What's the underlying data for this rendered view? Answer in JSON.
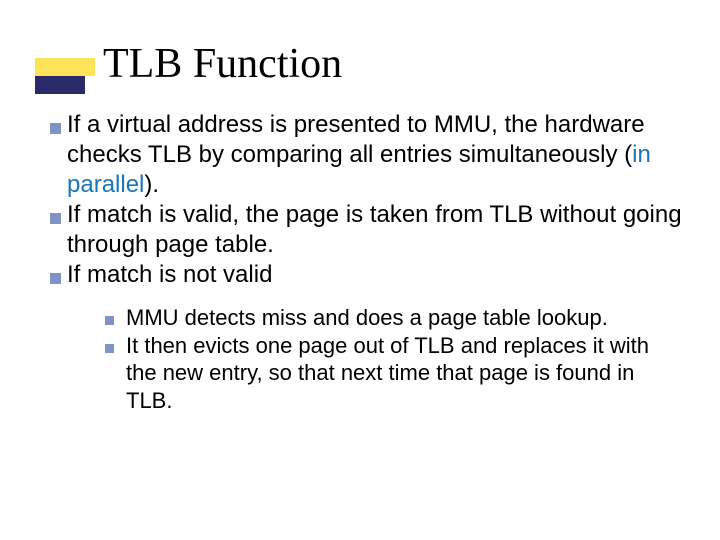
{
  "title": "TLB Function",
  "bullets": [
    {
      "pre": "If a virtual address is presented to MMU, the hardware checks TLB by comparing all entries simultaneously (",
      "hl": "in parallel",
      "post": ")."
    },
    {
      "text": "If match is valid, the page is taken from TLB without going through page table."
    },
    {
      "text": "If match is not valid"
    }
  ],
  "sub_bullets": [
    {
      "text": "MMU detects miss and does a page table lookup."
    },
    {
      "text": "It then evicts one page out of TLB and replaces it with the new entry, so that next time that page is found in TLB."
    }
  ]
}
